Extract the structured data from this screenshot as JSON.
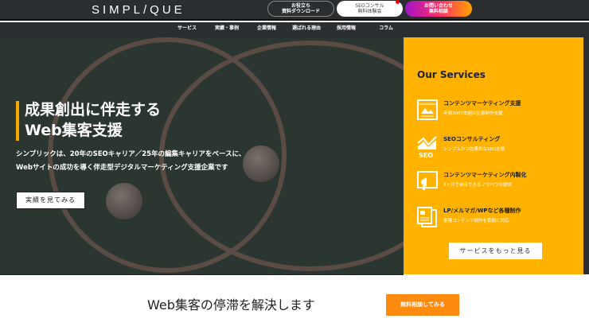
{
  "header": {
    "logo": "SIMPL/QUE",
    "download_btn": {
      "line1": "お役立ち",
      "line2": "資料ダウンロード"
    },
    "seo_btn": {
      "line1": "SEOコンサル",
      "line2": "無料体験会"
    },
    "contact_btn": {
      "line1": "お問い合わせ",
      "line2": "無料相談"
    }
  },
  "nav": [
    "サービス",
    "実績・事例",
    "企業情報",
    "選ばれる理由",
    "採用情報",
    "コラム"
  ],
  "hero": {
    "title_line1": "成果創出に伴走する",
    "title_line2": "Web集客支援",
    "desc_line1": "シンプリックは、20年のSEOキャリア／25年の編集キャリアをベースに、",
    "desc_line2": "Webサイトの成功を導く伴走型デジタルマーケティング支援企業です",
    "cta": "実績を見てみる"
  },
  "services": {
    "title": "Our Services",
    "items": [
      {
        "title": "コンテンツマーケティング支援",
        "sub": "年間3000本超の記事制作支援",
        "icon": "browser-image-icon"
      },
      {
        "title": "SEOコンサルティング",
        "sub": "シンプルかつ効果的なSEO支援",
        "icon": "seo-chart-icon"
      },
      {
        "title": "コンテンツマーケティング内製化",
        "sub": "3ヶ月で自走できるノウハウの提供",
        "icon": "megaphone-icon"
      },
      {
        "title": "LP/メルマガ/WPなど各種制作",
        "sub": "各種コンテンツ制作を柔軟に対応",
        "icon": "documents-icon"
      }
    ],
    "more": "サービスをもっと見る",
    "seo_label": "SEO"
  },
  "bottom": {
    "title": "Web集客の停滞を解決します",
    "cta": "無料相談してみる"
  }
}
